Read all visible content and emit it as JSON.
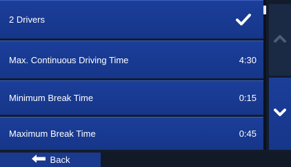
{
  "settings": {
    "items": [
      {
        "label": "2 Drivers",
        "value": "",
        "checked": true
      },
      {
        "label": "Max. Continuous Driving Time",
        "value": "4:30"
      },
      {
        "label": "Minimum Break Time",
        "value": "0:15"
      },
      {
        "label": "Maximum Break Time",
        "value": "0:45"
      }
    ]
  },
  "scroll": {
    "up_icon": "chevron-up-icon",
    "down_icon": "chevron-down-icon"
  },
  "footer": {
    "back_label": "Back",
    "back_icon": "arrow-left-icon"
  },
  "colors": {
    "row_bg": "#1b3e9a",
    "background": "#131c2b",
    "text": "#ffffff",
    "up_button_bg": "#1a2a45"
  }
}
